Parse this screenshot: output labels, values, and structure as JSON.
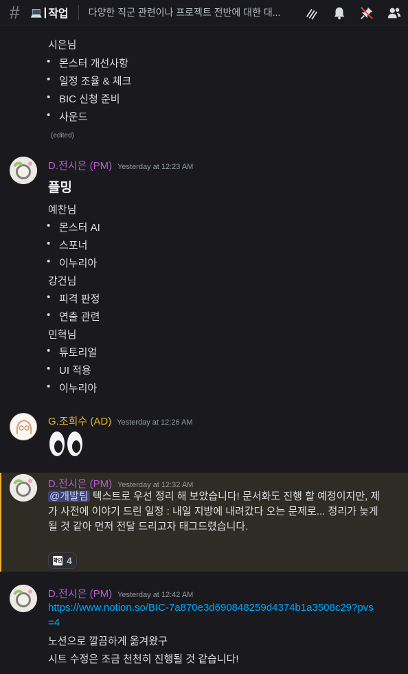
{
  "header": {
    "channel_emoji": "💻",
    "channel_pipe": "|",
    "channel_name": "작업",
    "topic": "다양한 직군 관련이나 프로젝트 전반에 대한 대..."
  },
  "messages": [
    {
      "continuation": true,
      "lines": [
        {
          "kind": "text",
          "text": "시은님"
        },
        {
          "kind": "bullet",
          "text": "몬스터 개선사항"
        },
        {
          "kind": "bullet",
          "text": "일정 조율 & 체크"
        },
        {
          "kind": "bullet",
          "text": "BIC 신청 준비"
        },
        {
          "kind": "bullet",
          "text": "사운드"
        }
      ],
      "edited": "(edited)"
    },
    {
      "author": "D.전시은 (PM)",
      "timestamp": "Yesterday at 12:23 AM",
      "heading": "플밍",
      "lines": [
        {
          "kind": "text",
          "text": "예찬님"
        },
        {
          "kind": "bullet",
          "text": "몬스터 AI"
        },
        {
          "kind": "bullet",
          "text": "스포너"
        },
        {
          "kind": "bullet",
          "text": "이누리아"
        },
        {
          "kind": "text",
          "text": "강건님"
        },
        {
          "kind": "bullet",
          "text": "피격 판정"
        },
        {
          "kind": "bullet",
          "text": "연출 관련"
        },
        {
          "kind": "text",
          "text": "민혁님"
        },
        {
          "kind": "bullet",
          "text": "튜토리얼"
        },
        {
          "kind": "bullet",
          "text": "UI 적용"
        },
        {
          "kind": "bullet",
          "text": "이누리아"
        }
      ]
    },
    {
      "author": "G.조희수 (AD)",
      "timestamp": "Yesterday at 12:26 AM",
      "emoji": "eyes"
    },
    {
      "author": "D.전시은 (PM)",
      "timestamp": "Yesterday at 12:32 AM",
      "mention": "@개발팀",
      "text": " 텍스트로 우선 정리 해 보았습니다! 문서화도 진행 할 예정이지만, 제가 사전에 이야기 드린 일정 : 내일 지방에 내려갔다 오는 문제로... 정리가 늦게 될 것 같아 먼저 전달 드리고자 태그드렸습니다.",
      "reaction": {
        "emoji_label": "확인",
        "count": "4"
      }
    },
    {
      "author": "D.전시은 (PM)",
      "timestamp": "Yesterday at 12:42 AM",
      "link": "https://www.notion.so/BIC-7a870e3d690848259d4374b1a3508c29?pvs=4",
      "line1": "노션으로 깔끔하게 옮겨왔구",
      "line2": "시트 수정은 조금 천천히 진행될 것 같습니다!"
    }
  ],
  "colors": {
    "pm": "#b55bd0",
    "ad": "#e6b520",
    "link": "#00a8fc",
    "highlight_bg": "#2f2c25"
  },
  "icons": [
    "hash-icon",
    "threads-icon",
    "bell-icon",
    "pin-icon",
    "members-icon"
  ]
}
